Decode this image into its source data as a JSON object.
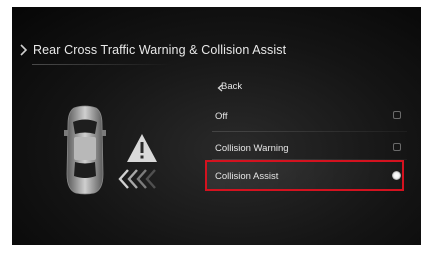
{
  "header": {
    "title": "Rear Cross Traffic Warning & Collision Assist"
  },
  "menu": {
    "back_label": "Back",
    "items": [
      {
        "label": "Off",
        "selected": false
      },
      {
        "label": "Collision Warning",
        "selected": false
      },
      {
        "label": "Collision Assist",
        "selected": true
      }
    ]
  },
  "illustration": {
    "car_icon": "car-top-view-icon",
    "warning_icon": "warning-triangle-icon",
    "arrows_icon": "incoming-traffic-arrows-icon"
  },
  "colors": {
    "highlight": "#d4121f",
    "background": "#141414",
    "text": "#e6e6e6"
  }
}
